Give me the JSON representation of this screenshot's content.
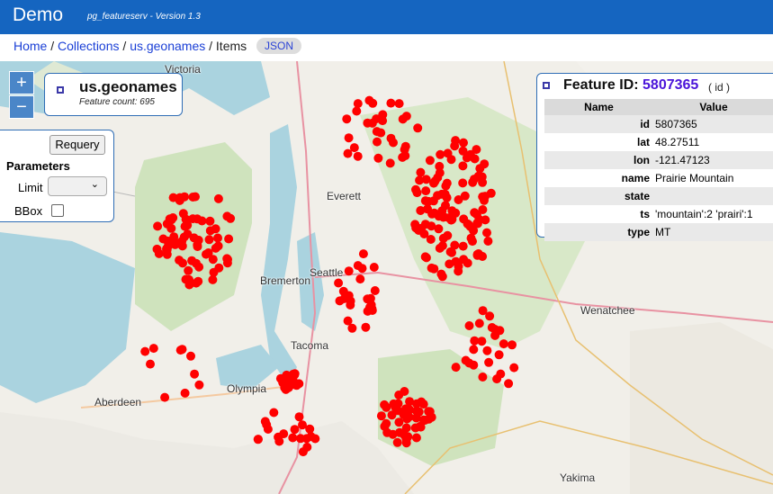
{
  "header": {
    "title": "Demo",
    "subtitle": "pg_featureserv - Version 1.3"
  },
  "breadcrumb": {
    "home": "Home",
    "sep1": " / ",
    "collections": "Collections",
    "sep2": " / ",
    "collection": "us.geonames",
    "sep3": " / ",
    "current": "Items",
    "json_button": "JSON"
  },
  "map": {
    "zoom_in": "+",
    "zoom_out": "−",
    "places": [
      "Victoria",
      "Everett",
      "Seattle",
      "Bremerton",
      "Tacoma",
      "Olympia",
      "Aberdeen",
      "Wenatchee",
      "Yakima"
    ],
    "point_color": "#ff0000"
  },
  "layer_panel": {
    "title": "us.geonames",
    "count_label": "Feature count: 695"
  },
  "query_panel": {
    "requery_label": "Requery",
    "parameters_label": "Parameters",
    "limit_label": "Limit",
    "bbox_label": "BBox"
  },
  "feature_panel": {
    "prefix": "Feature ID: ",
    "feature_id": "5807365",
    "key_label": "( id )",
    "headers": [
      "Name",
      "Value"
    ],
    "rows": [
      {
        "name": "id",
        "value": "5807365"
      },
      {
        "name": "lat",
        "value": "48.27511"
      },
      {
        "name": "lon",
        "value": "-121.47123"
      },
      {
        "name": "name",
        "value": "Prairie Mountain"
      },
      {
        "name": "state",
        "value": ""
      },
      {
        "name": "ts",
        "value": "'mountain':2 'prairi':1"
      },
      {
        "name": "type",
        "value": "MT"
      }
    ]
  }
}
